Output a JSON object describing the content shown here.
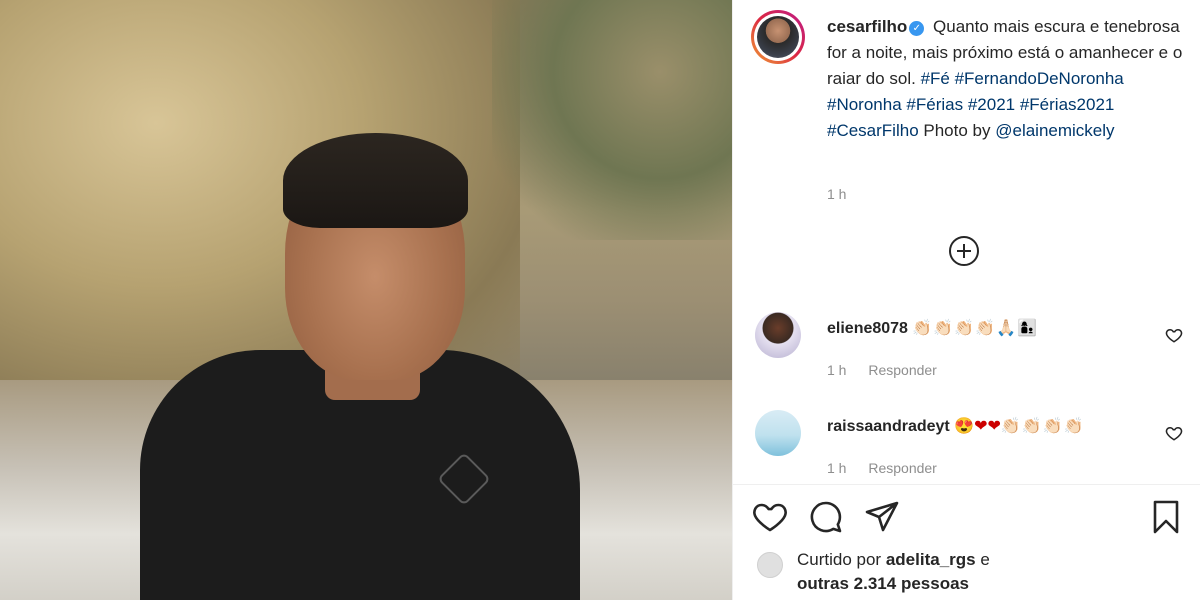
{
  "post": {
    "username": "cesarfilho",
    "caption_text": "Quanto mais escura e tenebrosa for a noite, mais próximo está o amanhecer e o raiar do sol.",
    "hashtags": [
      "#Fé",
      "#FernandoDeNoronha",
      "#Noronha",
      "#Férias",
      "#2021",
      "#Férias2021",
      "#CesarFilho"
    ],
    "photo_credit_prefix": "Photo by",
    "photo_credit_mention": "@elainemickely",
    "time": "1 h"
  },
  "comments": [
    {
      "username": "eliene8078",
      "emojis": "👏🏻👏🏻👏🏻👏🏻🙏🏻👩‍👦",
      "time": "1 h",
      "reply_label": "Responder"
    },
    {
      "username": "raissaandradeyt",
      "emojis": "😍",
      "hearts": "❤❤",
      "emojis_after": "👏🏻👏🏻👏🏻👏🏻",
      "time": "1 h",
      "reply_label": "Responder"
    }
  ],
  "likes": {
    "prefix": "Curtido por",
    "user": "adelita_rgs",
    "suffix": "e",
    "others": "outras 2.314 pessoas"
  },
  "icons": {
    "like": "heart-icon",
    "comment": "comment-icon",
    "share": "share-icon",
    "save": "bookmark-icon",
    "load_more": "plus-circle-icon"
  },
  "colors": {
    "link": "#00376b",
    "verified": "#3897f0",
    "muted": "#8e8e8e"
  }
}
